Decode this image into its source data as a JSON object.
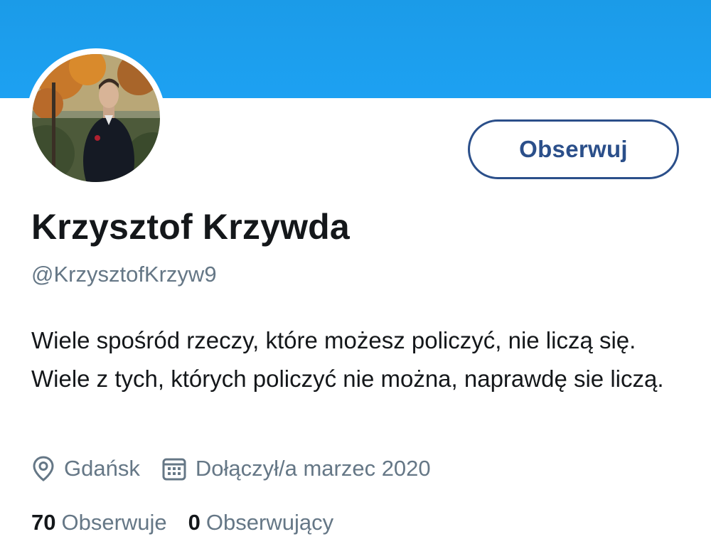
{
  "profile": {
    "display_name": "Krzysztof Krzywda",
    "handle": "@KrzysztofKrzyw9",
    "bio": "Wiele spośród rzeczy, które możesz policzyć, nie liczą się. Wiele z tych, których policzyć nie można, naprawdę sie liczą.",
    "location": "Gdańsk",
    "joined": "Dołączył/a marzec 2020"
  },
  "actions": {
    "follow_label": "Obserwuj"
  },
  "stats": {
    "following_count": "70",
    "following_label": "Obserwuje",
    "followers_count": "0",
    "followers_label": "Obserwujący"
  },
  "icons": {
    "location": "location-pin-icon",
    "calendar": "calendar-icon"
  },
  "colors": {
    "banner": "#1da1f2",
    "follow_button": "#2b4f8a",
    "secondary_text": "#657786",
    "primary_text": "#14171a"
  }
}
